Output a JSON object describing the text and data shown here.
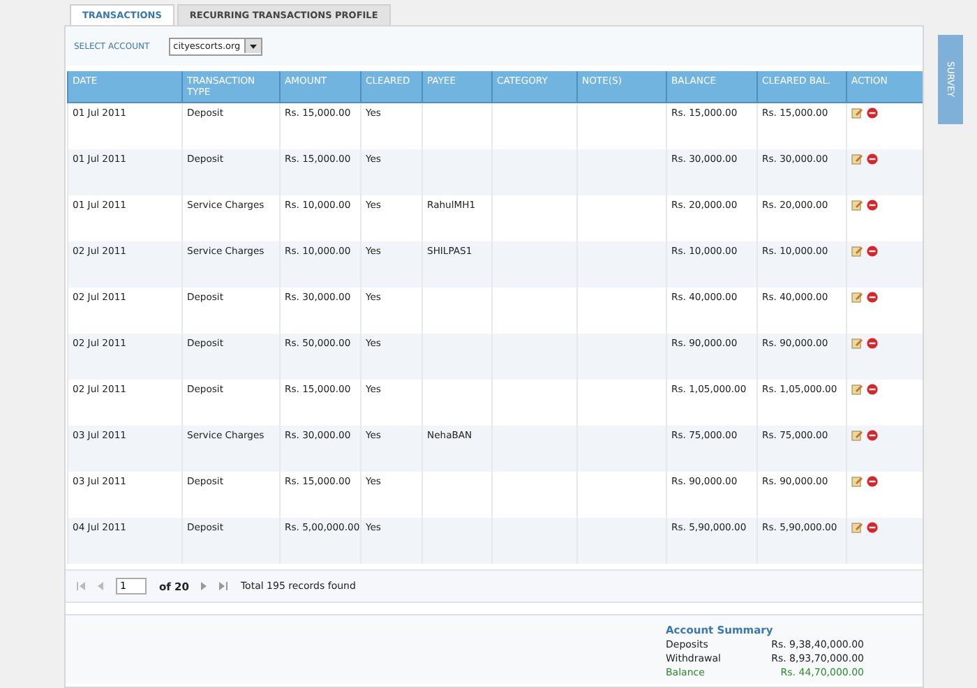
{
  "tabs": [
    {
      "label": "TRANSACTIONS",
      "selected": true
    },
    {
      "label": "RECURRING TRANSACTIONS PROFILE",
      "selected": false
    }
  ],
  "account_select": {
    "label": "SELECT ACCOUNT",
    "value": "cityescorts.org"
  },
  "survey_tab": {
    "label": "SURVEY"
  },
  "table": {
    "columns": [
      "DATE",
      "TRANSACTION TYPE",
      "AMOUNT",
      "CLEARED",
      "PAYEE",
      "CATEGORY",
      "NOTE(S)",
      "BALANCE",
      "CLEARED BAL.",
      "ACTION"
    ],
    "rows": [
      {
        "date": "01 Jul 2011",
        "type": "Deposit",
        "amount": "Rs. 15,000.00",
        "cleared": "Yes",
        "payee": "",
        "balance": "Rs. 15,000.00",
        "cleared_bal": "Rs. 15,000.00"
      },
      {
        "date": "01 Jul 2011",
        "type": "Deposit",
        "amount": "Rs. 15,000.00",
        "cleared": "Yes",
        "payee": "",
        "balance": "Rs. 30,000.00",
        "cleared_bal": "Rs. 30,000.00"
      },
      {
        "date": "01 Jul 2011",
        "type": "Service Charges",
        "amount": "Rs. 10,000.00",
        "cleared": "Yes",
        "payee": "RahulMH1",
        "balance": "Rs. 20,000.00",
        "cleared_bal": "Rs. 20,000.00"
      },
      {
        "date": "02 Jul 2011",
        "type": "Service Charges",
        "amount": "Rs. 10,000.00",
        "cleared": "Yes",
        "payee": "SHILPAS1",
        "balance": "Rs. 10,000.00",
        "cleared_bal": "Rs. 10,000.00"
      },
      {
        "date": "02 Jul 2011",
        "type": "Deposit",
        "amount": "Rs. 30,000.00",
        "cleared": "Yes",
        "payee": "",
        "balance": "Rs. 40,000.00",
        "cleared_bal": "Rs. 40,000.00"
      },
      {
        "date": "02 Jul 2011",
        "type": "Deposit",
        "amount": "Rs. 50,000.00",
        "cleared": "Yes",
        "payee": "",
        "balance": "Rs. 90,000.00",
        "cleared_bal": "Rs. 90,000.00"
      },
      {
        "date": "02 Jul 2011",
        "type": "Deposit",
        "amount": "Rs. 15,000.00",
        "cleared": "Yes",
        "payee": "",
        "balance": "Rs. 1,05,000.00",
        "cleared_bal": "Rs. 1,05,000.00"
      },
      {
        "date": "03 Jul 2011",
        "type": "Service Charges",
        "amount": "Rs. 30,000.00",
        "cleared": "Yes",
        "payee": "NehaBAN",
        "balance": "Rs. 75,000.00",
        "cleared_bal": "Rs. 75,000.00"
      },
      {
        "date": "03 Jul 2011",
        "type": "Deposit",
        "amount": "Rs. 15,000.00",
        "cleared": "Yes",
        "payee": "",
        "balance": "Rs. 90,000.00",
        "cleared_bal": "Rs. 90,000.00"
      },
      {
        "date": "04 Jul 2011",
        "type": "Deposit",
        "amount": "Rs. 5,00,000.00",
        "cleared": "Yes",
        "payee": "",
        "balance": "Rs. 5,90,000.00",
        "cleared_bal": "Rs. 5,90,000.00"
      }
    ]
  },
  "pager": {
    "page": "1",
    "of": "of 20",
    "total": "Total 195 records found"
  },
  "account_summary": {
    "title": "Account Summary",
    "lines": [
      {
        "label": "Deposits",
        "value": "Rs. 9,38,40,000.00",
        "kind": "plain"
      },
      {
        "label": "Withdrawal",
        "value": "Rs. 8,93,70,000.00",
        "kind": "plain"
      },
      {
        "label": "Balance",
        "value": "Rs. 44,70,000.00",
        "kind": "total"
      }
    ]
  }
}
